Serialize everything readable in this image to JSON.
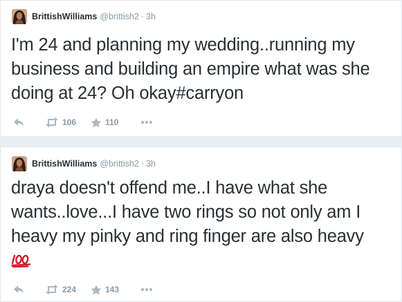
{
  "tweets": [
    {
      "author": "BrittishWilliams",
      "handle": "@brittish2",
      "separator": "·",
      "time": "3h",
      "text": "I'm 24 and planning my wedding..running my business and building an empire what was she doing at 24? Oh okay#carryon",
      "retweets": "106",
      "favorites": "110"
    },
    {
      "author": "BrittishWilliams",
      "handle": "@brittish2",
      "separator": "·",
      "time": "3h",
      "text": "draya doesn't offend me..I have what she wants..love...I have two rings so not only am I heavy my pinky and ring finger are also heavy",
      "emoji": "100",
      "retweets": "224",
      "favorites": "143"
    }
  ],
  "colors": {
    "background": "#e9eef2",
    "card": "#ffffff",
    "text": "#292f33",
    "muted": "#8899a6",
    "icon": "#aab8c2",
    "emoji_red": "#d41b2c"
  }
}
